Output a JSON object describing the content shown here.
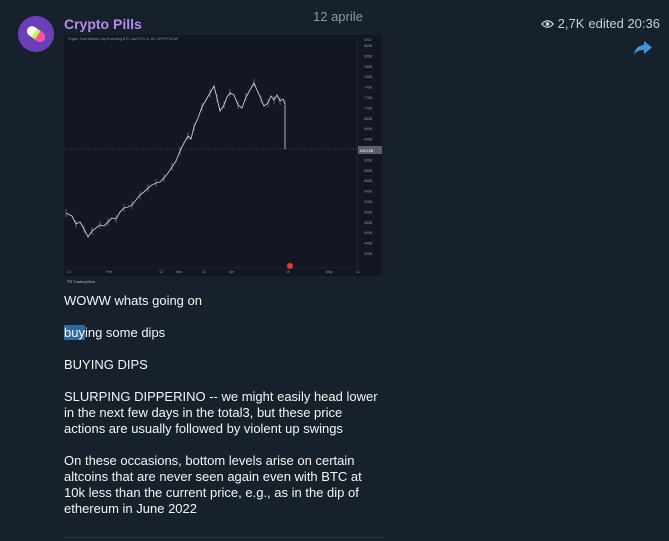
{
  "channel": {
    "name": "Crypto Pills",
    "date": "12 aprile"
  },
  "post": {
    "views": "2,7K",
    "edited": "edited 20:36",
    "paragraphs": {
      "p1": "WOWW whats going on",
      "p2_selected": "buy",
      "p2_rest": "ing some dips",
      "p3": "BUYING DIPS",
      "p4": "SLURPING DIPPERINO  -- we might easily head lower in the next few days in the total3, but these price actions are usually followed by violent up swings",
      "p5": "On these occasions, bottom levels arise on certain altcoins that are never seen again even with BTC at 10k less than the current price, e.g., as in the dip of ethereum in June 2022"
    }
  },
  "chart_image": {
    "title": "Crypto Total Market Cap Excluding BTC and ETH, $, 1D, CRYPTOCAP",
    "watermark": "TradingView",
    "currency": "USD",
    "x_ticks": [
      "13",
      "Feb",
      "12",
      "Mar",
      "11",
      "Apr",
      "15",
      "May",
      "11"
    ],
    "y_ticks": [
      "860B",
      "820B",
      "780B",
      "760B",
      "740B",
      "720B",
      "700B",
      "680B",
      "660B",
      "640B",
      "620B",
      "600B",
      "580B",
      "560B",
      "540B",
      "520B",
      "500B",
      "480B",
      "460B",
      "440B",
      "420B"
    ],
    "price_label": "609.16B",
    "colors": {
      "background": "#131722",
      "candles": "#c9ccd4",
      "accent": "#e53935"
    }
  },
  "icons": {
    "views": "eye-icon",
    "forward": "forward-arrow-icon",
    "avatar": "pill-icon"
  }
}
